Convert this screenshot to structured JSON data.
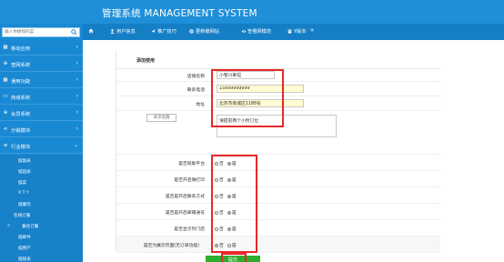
{
  "header": {
    "title": "管理系统 MANAGEMENT SYSTEM",
    "nav": [
      {
        "icon": "home-icon",
        "label": ""
      },
      {
        "icon": "user-icon",
        "label": "用户信息"
      },
      {
        "icon": "send-icon",
        "label": "推广技巧"
      },
      {
        "icon": "gear-icon",
        "label": "更新缓网站"
      },
      {
        "icon": "eye-icon",
        "label": "查看网模范"
      },
      {
        "icon": "doc-icon",
        "label": "Y版本"
      },
      {
        "icon": "double-chevron-icon",
        "label": "»"
      }
    ]
  },
  "sidebar": {
    "search_placeholder": "输入你想找的菜",
    "items": [
      {
        "icon": "grid-icon",
        "label": "移动应用"
      },
      {
        "icon": "globe-icon",
        "label": "查网系统"
      },
      {
        "icon": "grid-icon",
        "label": "通用功能"
      },
      {
        "icon": "inbox-icon",
        "label": "商城系统"
      },
      {
        "icon": "globe-icon",
        "label": "会员系统"
      },
      {
        "icon": "share-icon",
        "label": "分销模块"
      },
      {
        "icon": "list-icon",
        "label": "行业模块"
      }
    ],
    "submenu": [
      "摆副表",
      "摆园表",
      "摆菜",
      "X T Y",
      "摆餐饮",
      "在线订餐",
      "餐住订餐",
      "摆邮件",
      "摆用户",
      "摆接表"
    ],
    "active_submenu_index": 6
  },
  "form": {
    "section_title": "添加使用",
    "labels": {
      "name": "店铺名称",
      "phone": "联系电话",
      "address": "地址",
      "dropdown": "请求提醒",
      "q1": "是否就助平台",
      "q2": "是否开启微打印",
      "q3": "是否是开启联系方式",
      "q4": "是否是开启邮箱通号",
      "q5": "是否显示列门店",
      "q6": "是否为展示页面(无订单功能)"
    },
    "values": {
      "name": "小邹川串馆",
      "phone": "15899999999",
      "address": "北京市南城区1188号",
      "notes": "请提前两个小时订位"
    },
    "radio_options": [
      "否",
      "是"
    ],
    "radio_selected": [
      1,
      1,
      1,
      1,
      1,
      0
    ],
    "submit_label": "提交"
  }
}
